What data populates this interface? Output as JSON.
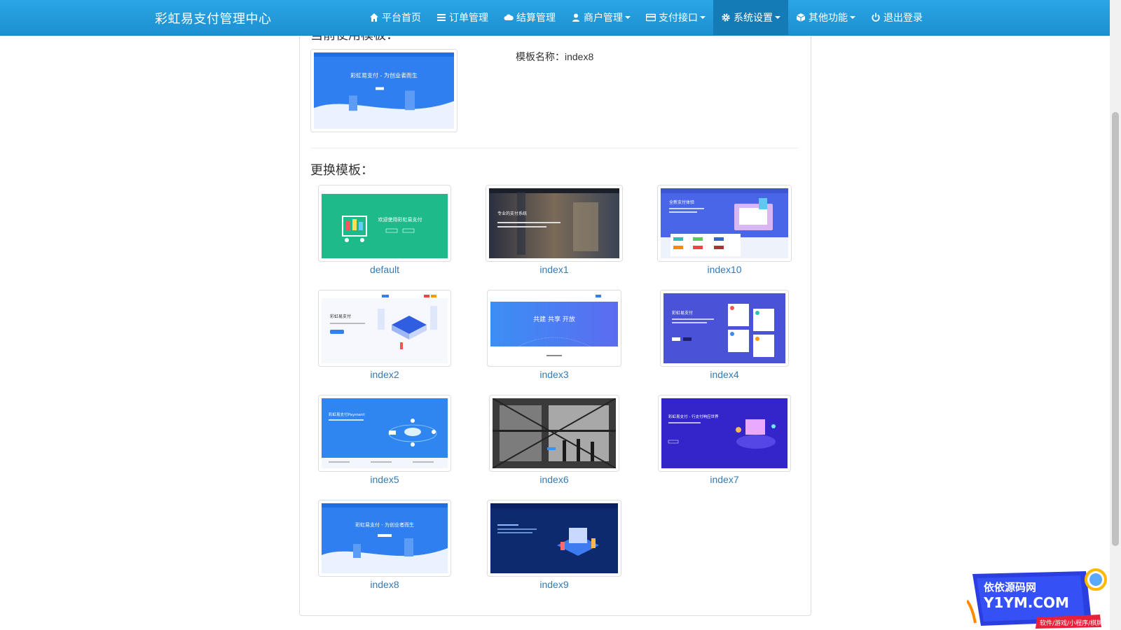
{
  "app": {
    "title": "彩虹易支付管理中心"
  },
  "nav": {
    "items": [
      {
        "label": "平台首页",
        "icon": "home-icon"
      },
      {
        "label": "订单管理",
        "icon": "list-icon"
      },
      {
        "label": "结算管理",
        "icon": "cloud-icon"
      },
      {
        "label": "商户管理",
        "icon": "user-icon",
        "dropdown": true
      },
      {
        "label": "支付接口",
        "icon": "credit-card-icon",
        "dropdown": true
      },
      {
        "label": "系统设置",
        "icon": "gear-icon",
        "dropdown": true,
        "active": true
      },
      {
        "label": "其他功能",
        "icon": "cube-icon",
        "dropdown": true
      },
      {
        "label": "退出登录",
        "icon": "power-icon"
      }
    ]
  },
  "current": {
    "heading": "当前使用模板：",
    "template_name": "模板名称：index8",
    "thumb_headline": "彩虹易支付 - 为创业者而生"
  },
  "change": {
    "heading": "更换模板："
  },
  "templates": [
    {
      "name": "default"
    },
    {
      "name": "index1"
    },
    {
      "name": "index10"
    },
    {
      "name": "index2"
    },
    {
      "name": "index3"
    },
    {
      "name": "index4"
    },
    {
      "name": "index5"
    },
    {
      "name": "index6"
    },
    {
      "name": "index7"
    },
    {
      "name": "index8"
    },
    {
      "name": "index9"
    }
  ],
  "thumb_texts": {
    "default": "欢迎使用彩虹易支付",
    "index1": "专业的支付系统",
    "index10": "全新支付体验",
    "index2": "彩虹易支付",
    "index3": "共建  共享  开放",
    "index4": "彩虹易支付",
    "index5": "彩虹易支付Payment",
    "index7": "彩虹易支付 - 行支付响应世界",
    "index8": "彩虹易支付 - 为创业者而生"
  },
  "watermark": {
    "line1": "依依源码网",
    "line2": "Y1YM.COM",
    "line3": "软件/游戏/小程序/棋牌"
  },
  "colors": {
    "nav_bg": "#1d8fcf",
    "nav_active": "#157bb6",
    "link": "#337ab7"
  }
}
